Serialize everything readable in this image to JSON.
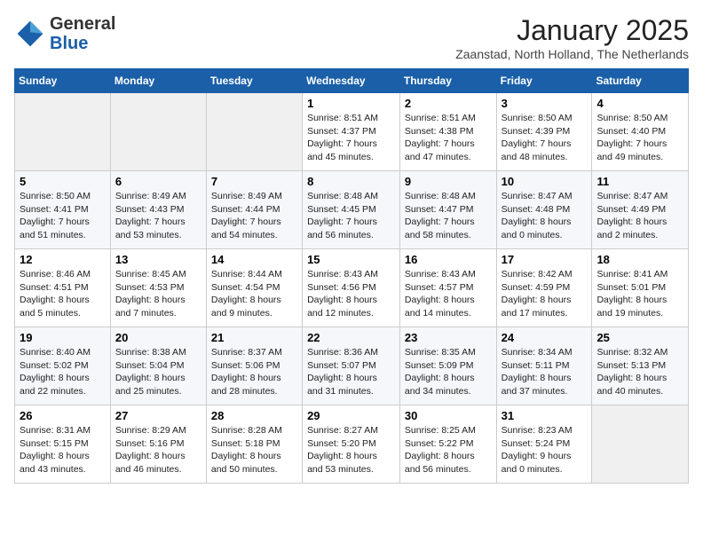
{
  "header": {
    "logo_line1": "General",
    "logo_line2": "Blue",
    "month_title": "January 2025",
    "location": "Zaanstad, North Holland, The Netherlands"
  },
  "weekdays": [
    "Sunday",
    "Monday",
    "Tuesday",
    "Wednesday",
    "Thursday",
    "Friday",
    "Saturday"
  ],
  "weeks": [
    [
      {
        "day": "",
        "content": ""
      },
      {
        "day": "",
        "content": ""
      },
      {
        "day": "",
        "content": ""
      },
      {
        "day": "1",
        "content": "Sunrise: 8:51 AM\nSunset: 4:37 PM\nDaylight: 7 hours\nand 45 minutes."
      },
      {
        "day": "2",
        "content": "Sunrise: 8:51 AM\nSunset: 4:38 PM\nDaylight: 7 hours\nand 47 minutes."
      },
      {
        "day": "3",
        "content": "Sunrise: 8:50 AM\nSunset: 4:39 PM\nDaylight: 7 hours\nand 48 minutes."
      },
      {
        "day": "4",
        "content": "Sunrise: 8:50 AM\nSunset: 4:40 PM\nDaylight: 7 hours\nand 49 minutes."
      }
    ],
    [
      {
        "day": "5",
        "content": "Sunrise: 8:50 AM\nSunset: 4:41 PM\nDaylight: 7 hours\nand 51 minutes."
      },
      {
        "day": "6",
        "content": "Sunrise: 8:49 AM\nSunset: 4:43 PM\nDaylight: 7 hours\nand 53 minutes."
      },
      {
        "day": "7",
        "content": "Sunrise: 8:49 AM\nSunset: 4:44 PM\nDaylight: 7 hours\nand 54 minutes."
      },
      {
        "day": "8",
        "content": "Sunrise: 8:48 AM\nSunset: 4:45 PM\nDaylight: 7 hours\nand 56 minutes."
      },
      {
        "day": "9",
        "content": "Sunrise: 8:48 AM\nSunset: 4:47 PM\nDaylight: 7 hours\nand 58 minutes."
      },
      {
        "day": "10",
        "content": "Sunrise: 8:47 AM\nSunset: 4:48 PM\nDaylight: 8 hours\nand 0 minutes."
      },
      {
        "day": "11",
        "content": "Sunrise: 8:47 AM\nSunset: 4:49 PM\nDaylight: 8 hours\nand 2 minutes."
      }
    ],
    [
      {
        "day": "12",
        "content": "Sunrise: 8:46 AM\nSunset: 4:51 PM\nDaylight: 8 hours\nand 5 minutes."
      },
      {
        "day": "13",
        "content": "Sunrise: 8:45 AM\nSunset: 4:53 PM\nDaylight: 8 hours\nand 7 minutes."
      },
      {
        "day": "14",
        "content": "Sunrise: 8:44 AM\nSunset: 4:54 PM\nDaylight: 8 hours\nand 9 minutes."
      },
      {
        "day": "15",
        "content": "Sunrise: 8:43 AM\nSunset: 4:56 PM\nDaylight: 8 hours\nand 12 minutes."
      },
      {
        "day": "16",
        "content": "Sunrise: 8:43 AM\nSunset: 4:57 PM\nDaylight: 8 hours\nand 14 minutes."
      },
      {
        "day": "17",
        "content": "Sunrise: 8:42 AM\nSunset: 4:59 PM\nDaylight: 8 hours\nand 17 minutes."
      },
      {
        "day": "18",
        "content": "Sunrise: 8:41 AM\nSunset: 5:01 PM\nDaylight: 8 hours\nand 19 minutes."
      }
    ],
    [
      {
        "day": "19",
        "content": "Sunrise: 8:40 AM\nSunset: 5:02 PM\nDaylight: 8 hours\nand 22 minutes."
      },
      {
        "day": "20",
        "content": "Sunrise: 8:38 AM\nSunset: 5:04 PM\nDaylight: 8 hours\nand 25 minutes."
      },
      {
        "day": "21",
        "content": "Sunrise: 8:37 AM\nSunset: 5:06 PM\nDaylight: 8 hours\nand 28 minutes."
      },
      {
        "day": "22",
        "content": "Sunrise: 8:36 AM\nSunset: 5:07 PM\nDaylight: 8 hours\nand 31 minutes."
      },
      {
        "day": "23",
        "content": "Sunrise: 8:35 AM\nSunset: 5:09 PM\nDaylight: 8 hours\nand 34 minutes."
      },
      {
        "day": "24",
        "content": "Sunrise: 8:34 AM\nSunset: 5:11 PM\nDaylight: 8 hours\nand 37 minutes."
      },
      {
        "day": "25",
        "content": "Sunrise: 8:32 AM\nSunset: 5:13 PM\nDaylight: 8 hours\nand 40 minutes."
      }
    ],
    [
      {
        "day": "26",
        "content": "Sunrise: 8:31 AM\nSunset: 5:15 PM\nDaylight: 8 hours\nand 43 minutes."
      },
      {
        "day": "27",
        "content": "Sunrise: 8:29 AM\nSunset: 5:16 PM\nDaylight: 8 hours\nand 46 minutes."
      },
      {
        "day": "28",
        "content": "Sunrise: 8:28 AM\nSunset: 5:18 PM\nDaylight: 8 hours\nand 50 minutes."
      },
      {
        "day": "29",
        "content": "Sunrise: 8:27 AM\nSunset: 5:20 PM\nDaylight: 8 hours\nand 53 minutes."
      },
      {
        "day": "30",
        "content": "Sunrise: 8:25 AM\nSunset: 5:22 PM\nDaylight: 8 hours\nand 56 minutes."
      },
      {
        "day": "31",
        "content": "Sunrise: 8:23 AM\nSunset: 5:24 PM\nDaylight: 9 hours\nand 0 minutes."
      },
      {
        "day": "",
        "content": ""
      }
    ]
  ]
}
